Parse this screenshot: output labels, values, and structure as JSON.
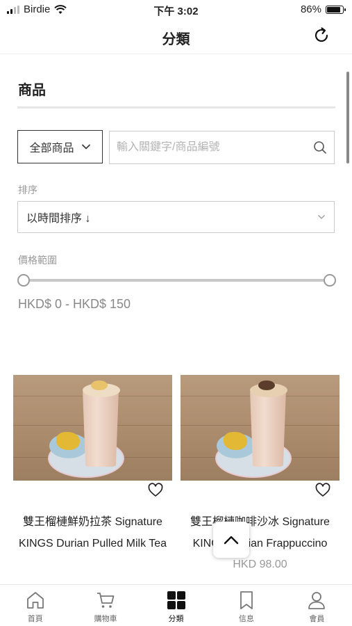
{
  "status_bar": {
    "carrier": "Birdie",
    "time": "下午 3:02",
    "battery": "86%",
    "battery_level": 0.86
  },
  "header": {
    "title": "分類",
    "refresh_icon": "refresh-icon"
  },
  "filters": {
    "section_title": "商品",
    "category_select": "全部商品",
    "search_placeholder": "輸入關鍵字/商品編號",
    "sort_label": "排序",
    "sort_value": "以時間排序 ↓",
    "price_label": "價格範圍",
    "price_min": 0,
    "price_max": 150,
    "price_range_text": "HKD$ 0 - HKD$ 150"
  },
  "products": [
    {
      "name": "雙王榴槤鮮奶拉茶 Signature KINGS Durian Pulled Milk Tea",
      "price": ""
    },
    {
      "name": "雙王榴槤咖啡沙冰 Signature KINGS Durian Frappuccino",
      "price": "HKD 98.00"
    }
  ],
  "tabbar": {
    "items": [
      {
        "label": "首頁",
        "icon": "home-icon"
      },
      {
        "label": "購物車",
        "icon": "cart-icon"
      },
      {
        "label": "分類",
        "icon": "grid-icon"
      },
      {
        "label": "信息",
        "icon": "bookmark-icon"
      },
      {
        "label": "會員",
        "icon": "user-icon"
      }
    ],
    "active_index": 2
  },
  "colors": {
    "text": "#222222",
    "muted": "#999999",
    "border": "#cccccc"
  }
}
